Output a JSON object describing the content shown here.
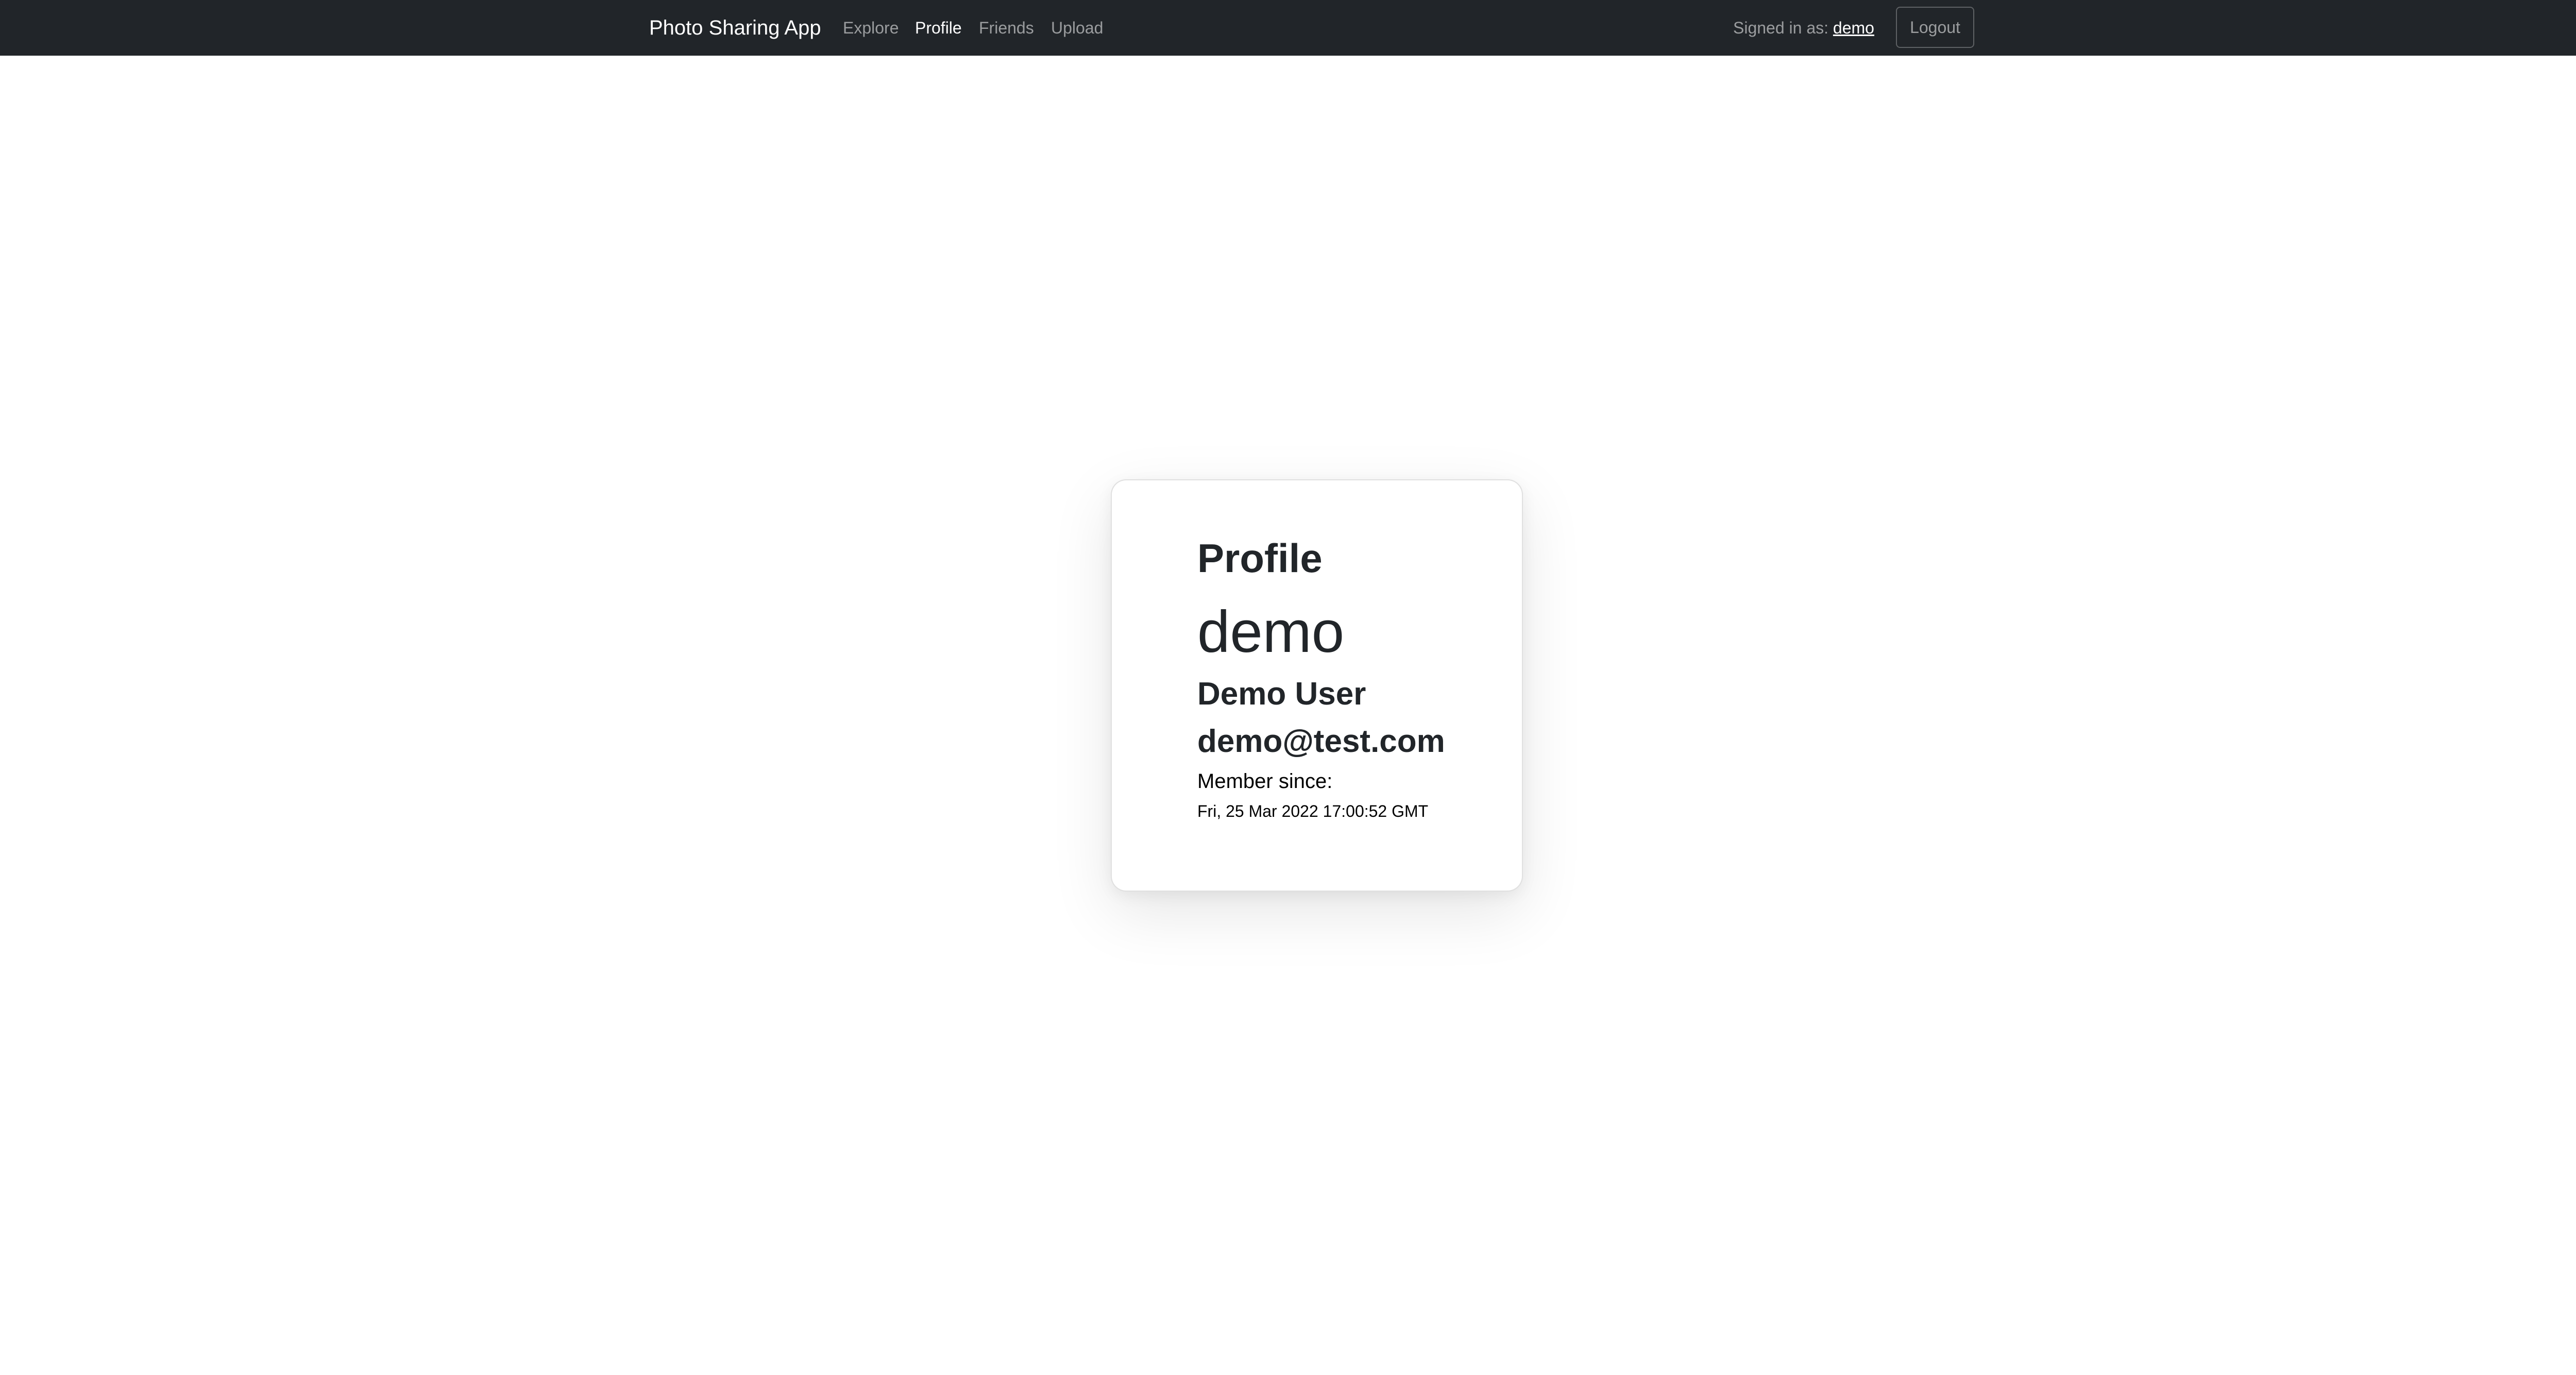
{
  "navbar": {
    "brand": "Photo Sharing App",
    "links": [
      {
        "label": "Explore",
        "active": false
      },
      {
        "label": "Profile",
        "active": true
      },
      {
        "label": "Friends",
        "active": false
      },
      {
        "label": "Upload",
        "active": false
      }
    ],
    "signed_in_prefix": "Signed in as:",
    "signed_in_user": "demo",
    "logout_label": "Logout"
  },
  "profile": {
    "heading": "Profile",
    "username": "demo",
    "full_name": "Demo User",
    "email": "demo@test.com",
    "member_since_label": "Member since:",
    "member_since_date": "Fri, 25 Mar 2022 17:00:52 GMT"
  },
  "colors": {
    "navbar_bg": "#212529",
    "page_bg": "#ffffff",
    "text": "#212529"
  }
}
